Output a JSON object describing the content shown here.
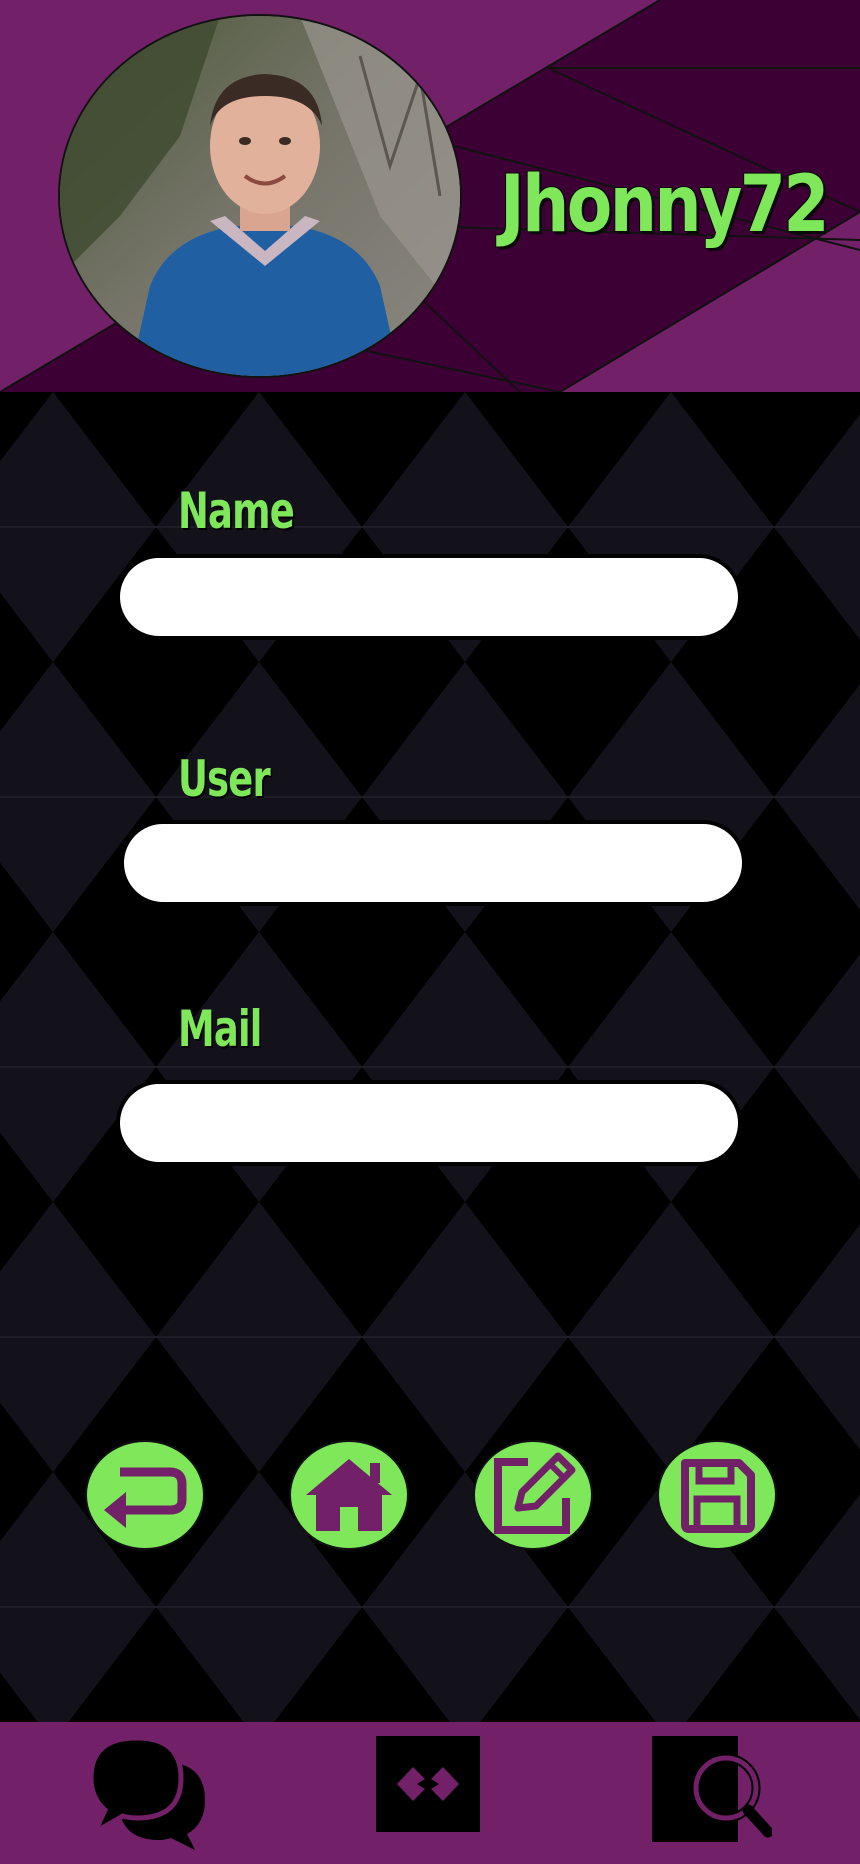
{
  "profile": {
    "username": "Jhonny72"
  },
  "form": {
    "fields": [
      {
        "label": "Name",
        "value": "",
        "placeholder": ""
      },
      {
        "label": "User",
        "value": "",
        "placeholder": ""
      },
      {
        "label": "Mail",
        "value": "",
        "placeholder": ""
      }
    ]
  },
  "actions": [
    {
      "icon": "return-icon"
    },
    {
      "icon": "home-icon"
    },
    {
      "icon": "edit-icon"
    },
    {
      "icon": "save-icon"
    }
  ],
  "bottom_nav": [
    {
      "icon": "chat-icon"
    },
    {
      "icon": "code-icon"
    },
    {
      "icon": "search-icon"
    }
  ],
  "colors": {
    "accent": "#7ee85a",
    "brand_purple": "#722169",
    "dark_purple": "#3d0035",
    "background": "#000000",
    "pattern": "#13121a"
  }
}
